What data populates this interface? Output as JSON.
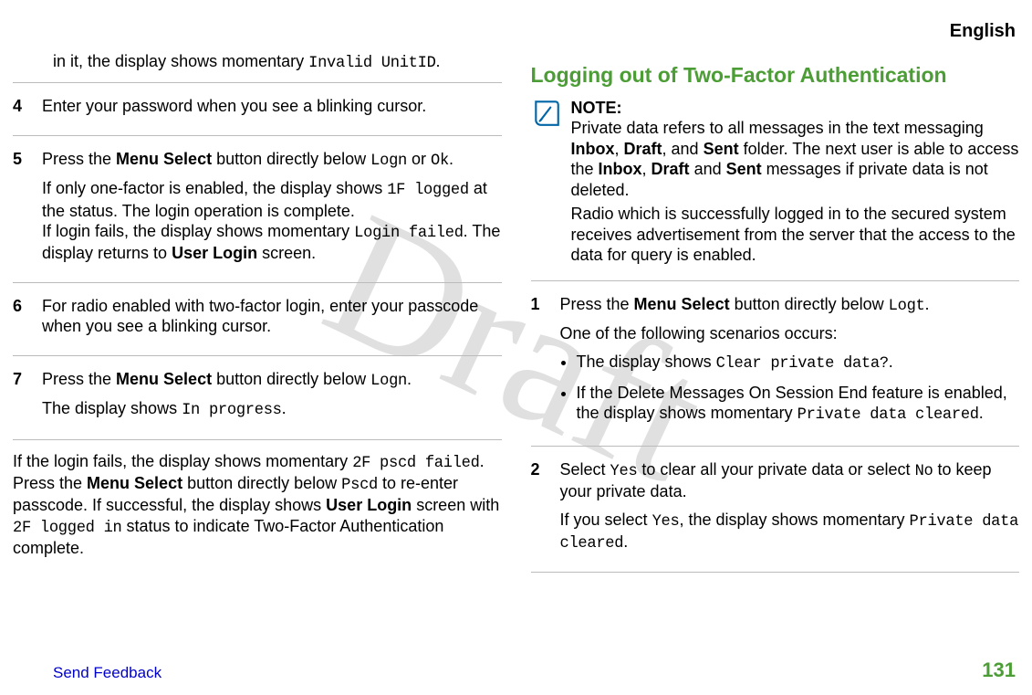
{
  "header": {
    "lang": "English"
  },
  "watermark": "Draft",
  "left": {
    "intro1": "in it, the display shows momentary ",
    "intro_code": "Invalid UnitID",
    "intro_end": ".",
    "step4": {
      "num": "4",
      "text": "Enter your password when you see a blinking cursor."
    },
    "step5": {
      "num": "5",
      "line1a": "Press the ",
      "menu": "Menu Select",
      "line1b": " button directly below ",
      "logn": "Logn",
      "or": " or ",
      "ok": "Ok",
      "dot": ".",
      "p2a": "If only one-factor is enabled, the display shows ",
      "p2_code": "1F logged",
      "p2b": " at the status. The login operation is complete.",
      "p3a": "If login fails, the display shows momentary ",
      "p3_code": "Login failed",
      "p3b": ". The display returns to ",
      "p3_bold": "User Login",
      "p3c": " screen."
    },
    "step6": {
      "num": "6",
      "text": "For radio enabled with two-factor login, enter your passcode when you see a blinking cursor."
    },
    "step7": {
      "num": "7",
      "line1a": "Press the ",
      "menu": "Menu Select",
      "line1b": " button directly below ",
      "logn": "Logn",
      "dot": ".",
      "p2a": "The display shows ",
      "p2_code": "In progress",
      "p2b": "."
    },
    "outro_a": "If the login fails, the display shows momentary ",
    "outro_code1": "2F pscd failed",
    "outro_b": ". Press the ",
    "outro_bold1": "Menu Select",
    "outro_c": " button directly below ",
    "outro_code2": "Pscd",
    "outro_d": " to re-enter passcode. If successful, the display shows ",
    "outro_bold2": "User Login",
    "outro_e": " screen with ",
    "outro_code3": "2F logged in",
    "outro_f": " status to indicate Two-Factor Authentication complete."
  },
  "right": {
    "heading": "Logging out of Two-Factor Authentication",
    "note_label": "NOTE:",
    "note_a": "Private data refers to all messages in the text messaging ",
    "note_b1": "Inbox",
    "note_comma1": ", ",
    "note_b2": "Draft",
    "note_comma2": ", and ",
    "note_b3": "Sent",
    "note_c": " folder. The next user is able to access the ",
    "note_b4": "Inbox",
    "note_comma3": ", ",
    "note_b5": "Draft",
    "note_and": " and ",
    "note_b6": "Sent",
    "note_d": " messages if private data is not deleted.",
    "note_p2": "Radio which is successfully logged in to the secured system receives advertisement from the server that the access to the data for query is enabled.",
    "step1": {
      "num": "1",
      "line1a": "Press the ",
      "menu": "Menu Select",
      "line1b": " button directly below ",
      "logt": "Logt",
      "dot": ".",
      "p2": "One of the following scenarios occurs:",
      "bullet1a": "The display shows ",
      "bullet1_code": "Clear private data?",
      "bullet1b": ".",
      "bullet2a": "If the Delete Messages On Session End feature is enabled, the display shows momentary ",
      "bullet2_code": "Private data cleared",
      "bullet2b": "."
    },
    "step2": {
      "num": "2",
      "line1a": "Select ",
      "yes": "Yes",
      "line1b": " to clear all your private data or select ",
      "no": "No",
      "line1c": " to keep your private data.",
      "p2a": "If you select ",
      "p2_code1": "Yes",
      "p2b": ", the display shows momentary ",
      "p2_code2": "Private data cleared",
      "p2c": "."
    }
  },
  "footer": {
    "feedback": "Send Feedback",
    "pagenum": "131"
  }
}
